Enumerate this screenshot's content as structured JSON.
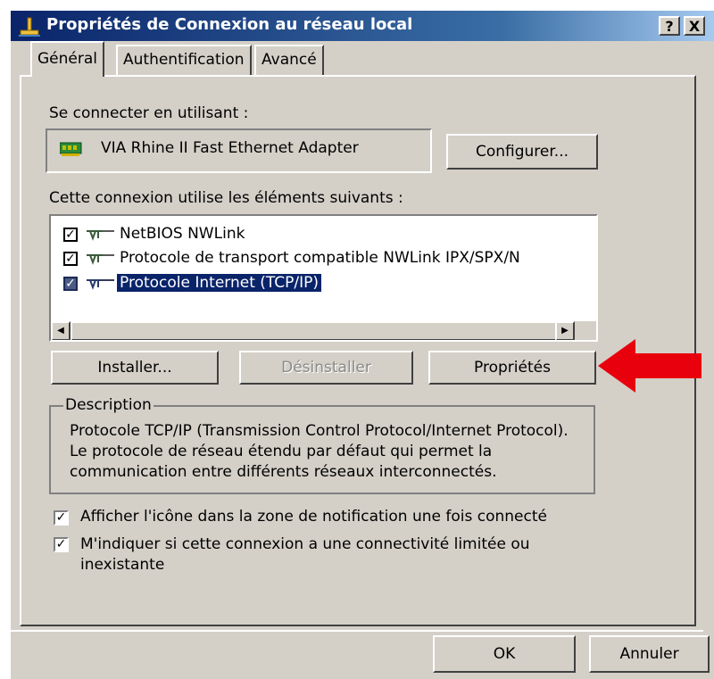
{
  "window": {
    "title": "Propriétés de Connexion au réseau local",
    "help_label": "?",
    "close_label": "X"
  },
  "tabs": [
    {
      "label": "Général",
      "active": true
    },
    {
      "label": "Authentification",
      "active": false
    },
    {
      "label": "Avancé",
      "active": false
    }
  ],
  "connect_using": {
    "label": "Se connecter en utilisant :",
    "adapter": "VIA Rhine II Fast Ethernet Adapter",
    "adapter_icon": "network-card-icon",
    "configure_button": "Configurer..."
  },
  "components": {
    "label": "Cette connexion utilise les éléments suivants :",
    "items": [
      {
        "label": "NetBIOS NWLink",
        "checked": true,
        "selected": false,
        "icon": "protocol-icon"
      },
      {
        "label": "Protocole de transport compatible NWLink IPX/SPX/N",
        "checked": true,
        "selected": false,
        "icon": "protocol-icon"
      },
      {
        "label": "Protocole Internet (TCP/IP)",
        "checked": true,
        "selected": true,
        "icon": "protocol-icon"
      }
    ]
  },
  "buttons": {
    "install": "Installer...",
    "uninstall": "Désinstaller",
    "properties": "Propriétés"
  },
  "description": {
    "legend": "Description",
    "text": "Protocole TCP/IP (Transmission Control Protocol/Internet Protocol). Le protocole de réseau étendu par défaut qui permet la communication entre différents réseaux interconnectés."
  },
  "options": [
    {
      "label": "Afficher l'icône dans la zone de notification une fois connecté",
      "checked": true
    },
    {
      "label": "M'indiquer si cette connexion a une connectivité limitée ou inexistante",
      "checked": true
    }
  ],
  "footer": {
    "ok": "OK",
    "cancel": "Annuler"
  },
  "colors": {
    "dialog_face": "#d4d0c8",
    "title_bar": "#0a246a",
    "selection": "#0a246a",
    "annotation_arrow": "#e8000d"
  }
}
